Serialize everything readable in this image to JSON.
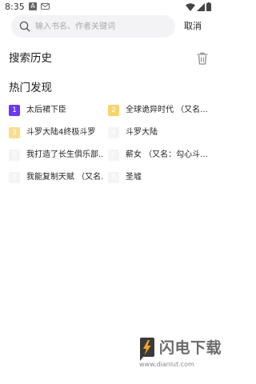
{
  "status_bar": {
    "time": "8:35",
    "notification_badge": "A"
  },
  "search": {
    "placeholder": "输入书名、作者关键词",
    "value": "",
    "cancel_label": "取消"
  },
  "history": {
    "title": "搜索历史"
  },
  "hot": {
    "title": "热门发现",
    "items": [
      {
        "rank": "1",
        "title": "太后裙下臣",
        "badge_color": "#6e36f0"
      },
      {
        "rank": "2",
        "title": "全球诡异时代 （又名...",
        "badge_color": "#f7d46a"
      },
      {
        "rank": "3",
        "title": "斗罗大陆4终极斗罗",
        "badge_color": "#f9dd8f"
      },
      {
        "rank": "4",
        "title": "斗罗大陆",
        "badge_color": "#f4f4f6"
      },
      {
        "rank": "5",
        "title": "我打造了长生俱乐部...",
        "badge_color": "#f4f4f6"
      },
      {
        "rank": "6",
        "title": "薪女 （又名：勾心斗...",
        "badge_color": "#f4f4f6"
      },
      {
        "rank": "7",
        "title": "我能复制天赋 （又名...",
        "badge_color": "#f4f4f6"
      },
      {
        "rank": "8",
        "title": "圣墟",
        "badge_color": "#f4f4f6"
      }
    ]
  },
  "watermark": {
    "brand": "闪电下载",
    "url": "www.dianlut.com"
  }
}
